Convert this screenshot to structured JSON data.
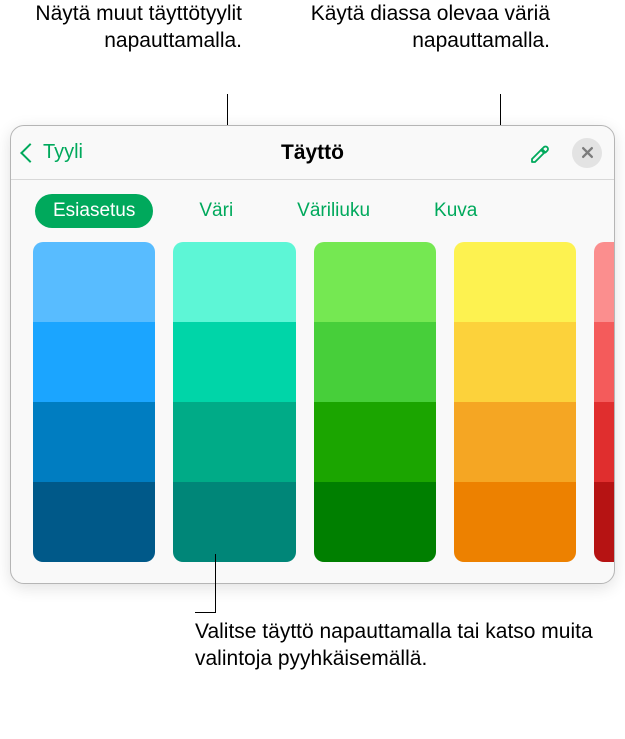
{
  "callouts": {
    "left": "Näytä muut täyttötyylit napauttamalla.",
    "right": "Käytä diassa olevaa väriä napauttamalla.",
    "bottom": "Valitse täyttö napauttamalla tai katso muita valintoja pyyhkäisemällä."
  },
  "panel": {
    "back_label": "Tyyli",
    "title": "Täyttö",
    "tabs": {
      "preset": "Esiasetus",
      "color": "Väri",
      "gradient": "Väriliuku",
      "image": "Kuva"
    }
  },
  "swatches": [
    [
      "#58bcff",
      "#1ba5ff",
      "#007dc1",
      "#005989"
    ],
    [
      "#5df6d6",
      "#00d5a8",
      "#00ab87",
      "#008678"
    ],
    [
      "#75e852",
      "#47cf3a",
      "#1ba500",
      "#007f00"
    ],
    [
      "#fdf250",
      "#fcd23b",
      "#f5a623",
      "#ed8100"
    ],
    [
      "#fb8e8e",
      "#f45b5b",
      "#e02e2e",
      "#b61313"
    ]
  ]
}
